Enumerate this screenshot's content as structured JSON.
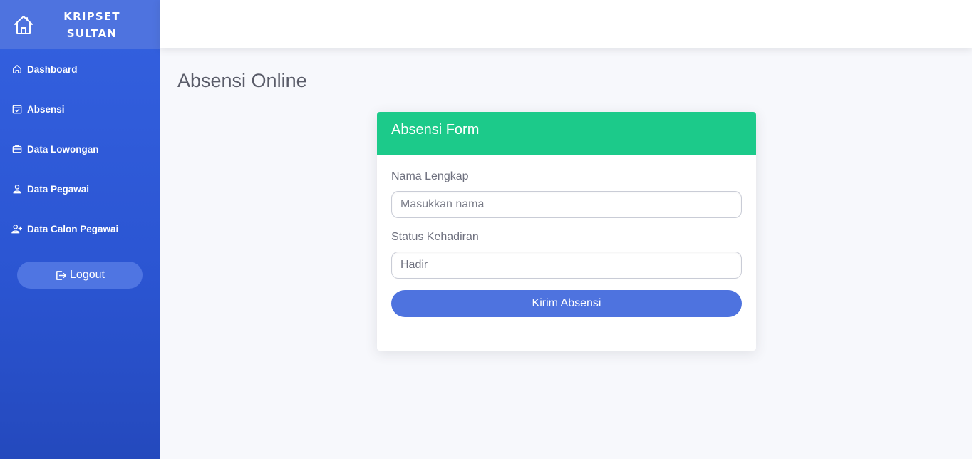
{
  "brand": {
    "line1": "KRIPSET",
    "line2": "SULTAN",
    "icon": "house-icon"
  },
  "sidebar": {
    "items": [
      {
        "label": "Dashboard",
        "icon": "home-icon"
      },
      {
        "label": "Absensi",
        "icon": "calendar-check-icon"
      },
      {
        "label": "Data Lowongan",
        "icon": "briefcase-icon"
      },
      {
        "label": "Data Pegawai",
        "icon": "user-icon"
      },
      {
        "label": "Data Calon Pegawai",
        "icon": "user-plus-icon"
      }
    ],
    "logout_label": "Logout"
  },
  "page": {
    "title": "Absensi Online"
  },
  "form": {
    "header": "Absensi Form",
    "name_label": "Nama Lengkap",
    "name_placeholder": "Masukkan nama",
    "status_label": "Status Kehadiran",
    "status_value": "Hadir",
    "submit_label": "Kirim Absensi"
  },
  "colors": {
    "sidebar": "#3461e0",
    "brand_bg": "#4e73df",
    "card_header": "#1cca8a",
    "primary_button": "#4e73df"
  }
}
